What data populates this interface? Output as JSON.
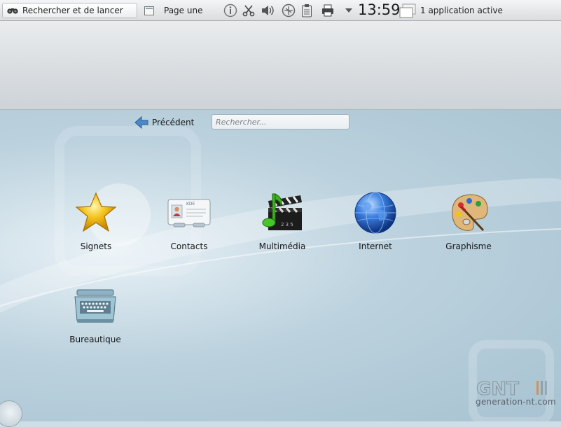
{
  "panel": {
    "launcher_label": "Rechercher et de lancer",
    "page_label": "Page une",
    "clock": "13:59",
    "tasks_label": "1 application active"
  },
  "nav": {
    "back_label": "Précédent",
    "search_placeholder": "Rechercher..."
  },
  "categories": [
    {
      "label": "Signets",
      "icon": "star-icon"
    },
    {
      "label": "Contacts",
      "icon": "address-card-icon"
    },
    {
      "label": "Multimédia",
      "icon": "clapperboard-music-icon"
    },
    {
      "label": "Internet",
      "icon": "globe-icon"
    },
    {
      "label": "Graphisme",
      "icon": "palette-icon"
    },
    {
      "label": "Bureautique",
      "icon": "typewriter-icon"
    }
  ],
  "contact_card_text": "KDE",
  "watermark": {
    "logo": "GNT",
    "url": "generation-nt.com"
  },
  "colors": {
    "panel_bg": "#e6e8ea",
    "desktop_bg": "#b9d0dc",
    "globe_blue": "#1d5fc4",
    "star_gold": "#f4c21a"
  }
}
